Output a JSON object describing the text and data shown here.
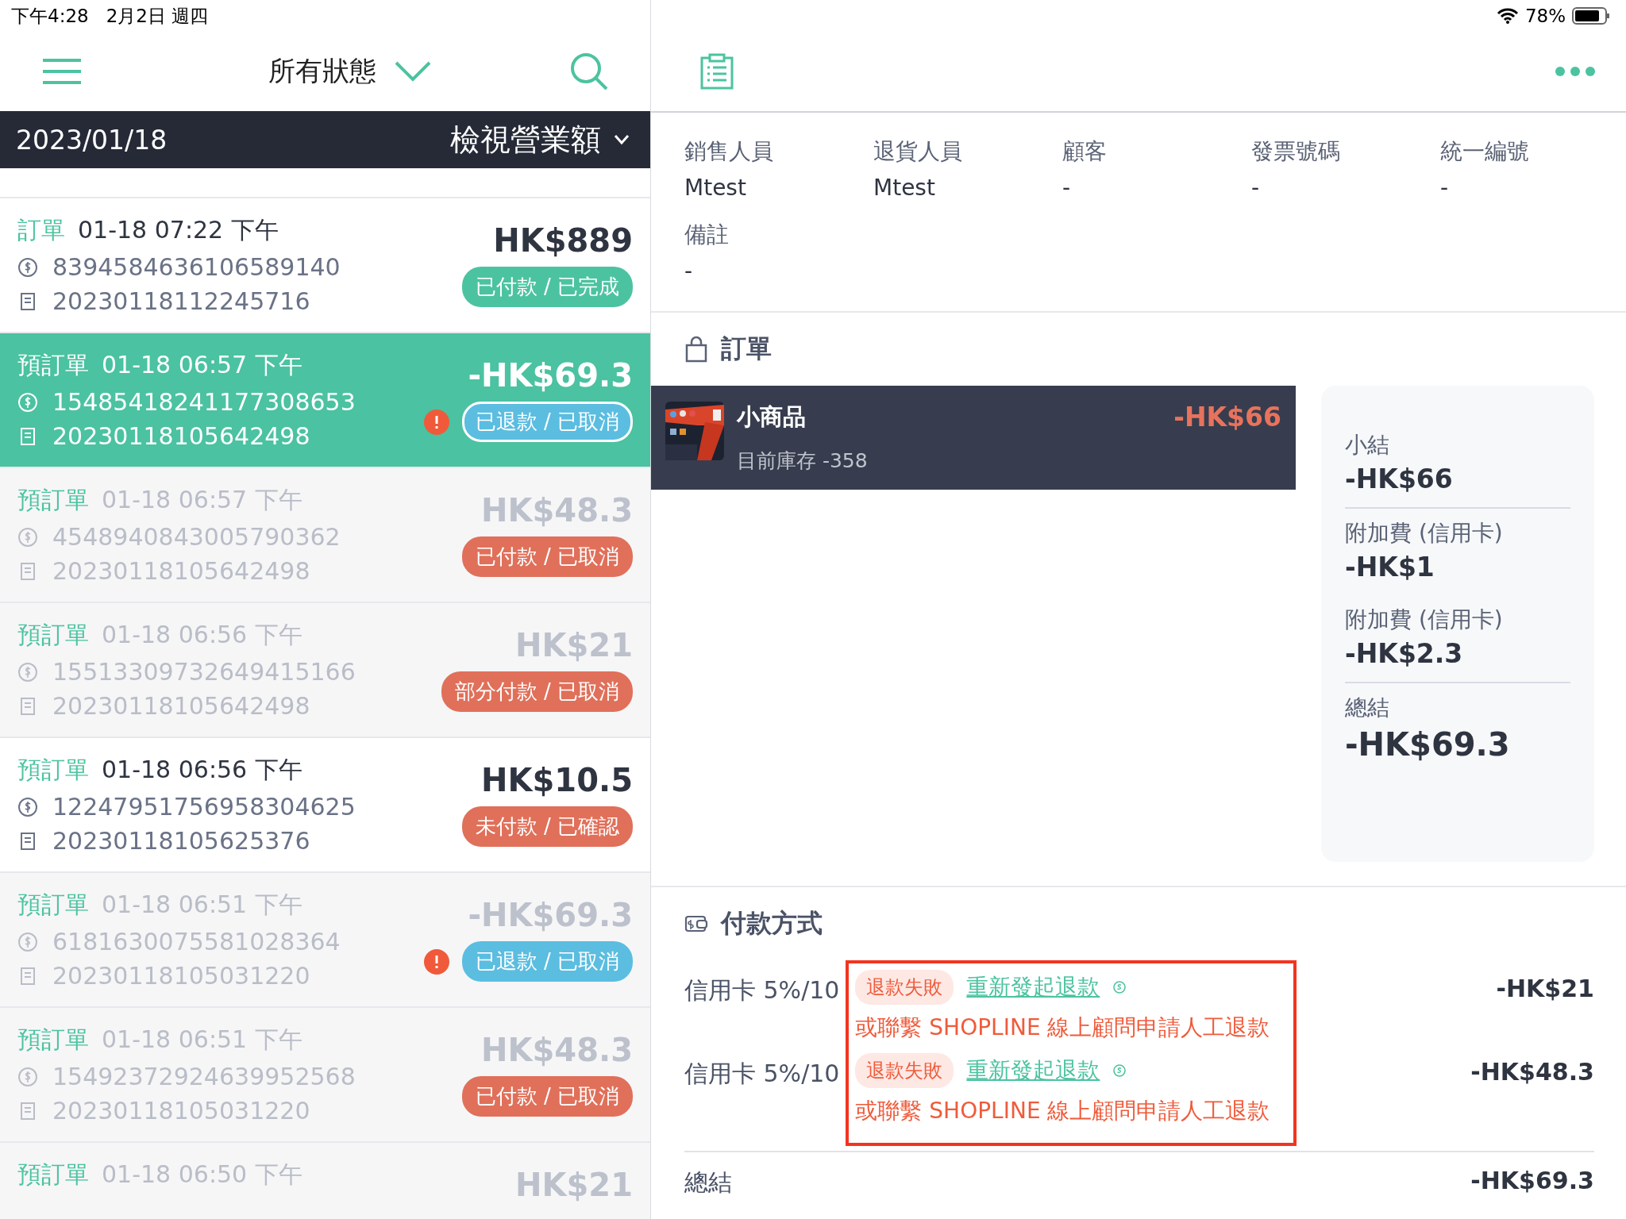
{
  "status_bar": {
    "time": "下午4:28",
    "date": "2月2日 週四",
    "battery": "78%"
  },
  "list_header": {
    "filter": "所有狀態"
  },
  "date_bar": {
    "date": "2023/01/18",
    "action": "檢視營業額"
  },
  "orders": [
    {
      "type": "訂單",
      "time": "01-18 07:22 下午",
      "payment_id": "8394584636106589140",
      "number": "20230118112245716",
      "amount": "HK$889",
      "status": "已付款 / 已完成",
      "color": "#4cc3a0",
      "alert": false,
      "faded": false,
      "selected": false
    },
    {
      "type": "預訂單",
      "time": "01-18 06:57 下午",
      "payment_id": "15485418241177308653",
      "number": "20230118105642498",
      "amount": "-HK$69.3",
      "status": "已退款 / 已取消",
      "color": "#5bbde0",
      "alert": true,
      "faded": false,
      "selected": true
    },
    {
      "type": "預訂單",
      "time": "01-18 06:57 下午",
      "payment_id": "4548940843005790362",
      "number": "20230118105642498",
      "amount": "HK$48.3",
      "status": "已付款 / 已取消",
      "color": "#e0705a",
      "alert": false,
      "faded": true,
      "selected": false
    },
    {
      "type": "預訂單",
      "time": "01-18 06:56 下午",
      "payment_id": "15513309732649415166",
      "number": "20230118105642498",
      "amount": "HK$21",
      "status": "部分付款 / 已取消",
      "color": "#e0705a",
      "alert": false,
      "faded": true,
      "selected": false
    },
    {
      "type": "預訂單",
      "time": "01-18 06:56 下午",
      "payment_id": "12247951756958304625",
      "number": "20230118105625376",
      "amount": "HK$10.5",
      "status": "未付款 / 已確認",
      "color": "#e0705a",
      "alert": false,
      "faded": false,
      "selected": false
    },
    {
      "type": "預訂單",
      "time": "01-18 06:51 下午",
      "payment_id": "6181630075581028364",
      "number": "20230118105031220",
      "amount": "-HK$69.3",
      "status": "已退款 / 已取消",
      "color": "#5bbde0",
      "alert": true,
      "faded": true,
      "selected": false
    },
    {
      "type": "預訂單",
      "time": "01-18 06:51 下午",
      "payment_id": "15492372924639952568",
      "number": "20230118105031220",
      "amount": "HK$48.3",
      "status": "已付款 / 已取消",
      "color": "#e0705a",
      "alert": false,
      "faded": true,
      "selected": false
    },
    {
      "type": "預訂單",
      "time": "01-18 06:50 下午",
      "amount": "HK$21",
      "alert": false,
      "faded": true,
      "selected": false
    }
  ],
  "info_fields": [
    {
      "label": "銷售人員",
      "value": "Mtest"
    },
    {
      "label": "退貨人員",
      "value": "Mtest"
    },
    {
      "label": "顧客",
      "value": "-"
    },
    {
      "label": "發票號碼",
      "value": "-"
    },
    {
      "label": "統一編號",
      "value": "-"
    },
    {
      "label": "備註",
      "value": "-"
    }
  ],
  "order_section": {
    "title": "訂單",
    "items": [
      {
        "name": "小商品",
        "stock": "目前庫存 -358",
        "price": "-HK$66"
      }
    ],
    "summary": [
      {
        "label": "小結",
        "value": "-HK$66",
        "divider": true,
        "large": false
      },
      {
        "label": "附加費 (信用卡)",
        "value": "-HK$1",
        "divider": false,
        "large": false
      },
      {
        "label": "附加費 (信用卡)",
        "value": "-HK$2.3",
        "divider": true,
        "large": false
      },
      {
        "label": "總結",
        "value": "-HK$69.3",
        "divider": false,
        "large": true
      }
    ]
  },
  "payment_section": {
    "title": "付款方式",
    "highlight": true,
    "payments": [
      {
        "method": "信用卡 5%/10",
        "status": "退款失敗",
        "retry_link": "重新發起退款",
        "note": "或聯繫 SHOPLINE 線上顧問申請人工退款",
        "amount": "-HK$21"
      },
      {
        "method": "信用卡 5%/10",
        "status": "退款失敗",
        "retry_link": "重新發起退款",
        "note": "或聯繫 SHOPLINE 線上顧問申請人工退款",
        "amount": "-HK$48.3"
      }
    ],
    "total": {
      "label": "總結",
      "value": "-HK$69.3"
    }
  }
}
